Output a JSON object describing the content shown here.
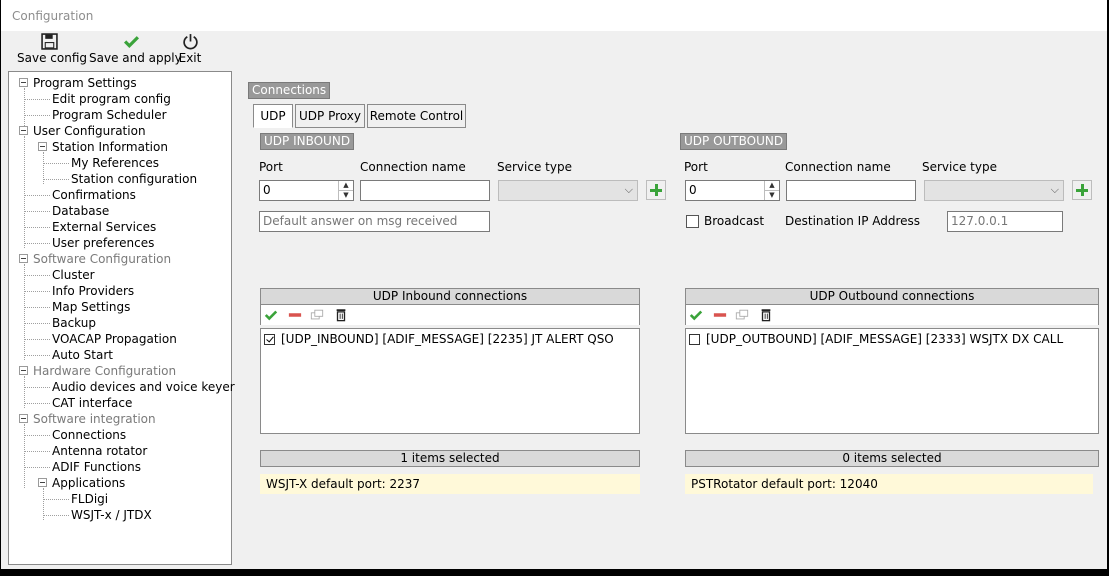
{
  "window": {
    "title": "Configuration"
  },
  "toolbar": {
    "save_config": "Save config",
    "save_apply": "Save and apply",
    "exit": "Exit"
  },
  "tree": [
    {
      "label": "Program Settings",
      "dim": false
    },
    {
      "label": "Edit program config",
      "dim": false
    },
    {
      "label": "Program Scheduler",
      "dim": false
    },
    {
      "label": "User Configuration",
      "dim": false
    },
    {
      "label": "Station Information",
      "dim": false
    },
    {
      "label": "My References",
      "dim": false
    },
    {
      "label": "Station configuration",
      "dim": false
    },
    {
      "label": "Confirmations",
      "dim": false
    },
    {
      "label": "Database",
      "dim": false
    },
    {
      "label": "External Services",
      "dim": false
    },
    {
      "label": "User preferences",
      "dim": false
    },
    {
      "label": "Software Configuration",
      "dim": true
    },
    {
      "label": "Cluster",
      "dim": false
    },
    {
      "label": "Info Providers",
      "dim": false
    },
    {
      "label": "Map Settings",
      "dim": false
    },
    {
      "label": "Backup",
      "dim": false
    },
    {
      "label": "VOACAP Propagation",
      "dim": false
    },
    {
      "label": "Auto Start",
      "dim": false
    },
    {
      "label": "Hardware Configuration",
      "dim": true
    },
    {
      "label": "Audio devices and voice keyer",
      "dim": false
    },
    {
      "label": "CAT interface",
      "dim": false
    },
    {
      "label": "Software integration",
      "dim": true
    },
    {
      "label": "Connections",
      "dim": false
    },
    {
      "label": "Antenna rotator",
      "dim": false
    },
    {
      "label": "ADIF Functions",
      "dim": false
    },
    {
      "label": "Applications",
      "dim": false
    },
    {
      "label": "FLDigi",
      "dim": false
    },
    {
      "label": "WSJT-x / JTDX",
      "dim": false
    }
  ],
  "main": {
    "group_title": "Connections",
    "tabs": [
      "UDP",
      "UDP Proxy",
      "Remote Control"
    ],
    "inbound": {
      "title": "UDP INBOUND",
      "port_label": "Port",
      "port_value": "0",
      "name_label": "Connection name",
      "name_value": "",
      "service_label": "Service type",
      "service_value": "",
      "default_answer_placeholder": "Default answer on msg received",
      "list_title": "UDP Inbound connections",
      "items": [
        {
          "checked": true,
          "text": "[UDP_INBOUND] [ADIF_MESSAGE] [2235] JT ALERT QSO"
        }
      ],
      "status": "1 items selected",
      "hint": "WSJT-X default port: 2237"
    },
    "outbound": {
      "title": "UDP OUTBOUND",
      "port_label": "Port",
      "port_value": "0",
      "name_label": "Connection name",
      "name_value": "",
      "service_label": "Service type",
      "service_value": "",
      "broadcast_label": "Broadcast",
      "broadcast_checked": false,
      "dest_ip_label": "Destination IP Address",
      "dest_ip_placeholder": "127.0.0.1",
      "list_title": "UDP Outbound connections",
      "items": [
        {
          "checked": false,
          "text": "[UDP_OUTBOUND] [ADIF_MESSAGE] [2333] WSJTX DX CALL"
        }
      ],
      "status": "0 items selected",
      "hint": "PSTRotator default port: 12040"
    }
  },
  "colors": {
    "accent_green": "#3aa33a",
    "remove_red": "#d9534f",
    "hint_bg": "#fff9d9",
    "group_title_bg": "#999999"
  }
}
